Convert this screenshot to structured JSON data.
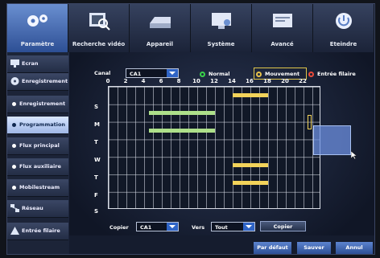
{
  "tabs": [
    {
      "label": "Paramètre",
      "icon": "gears-icon"
    },
    {
      "label": "Recherche vidéo",
      "icon": "video-search-icon"
    },
    {
      "label": "Appareil",
      "icon": "hard-drive-icon"
    },
    {
      "label": "Système",
      "icon": "monitor-icon"
    },
    {
      "label": "Avancé",
      "icon": "advanced-window-icon"
    },
    {
      "label": "Eteindre",
      "icon": "power-icon"
    }
  ],
  "sidebar": {
    "items": [
      {
        "label": "Ecran",
        "type": "group",
        "icon": "monitor-icon"
      },
      {
        "label": "Enregistrement",
        "type": "group",
        "icon": "film-reel-icon"
      },
      {
        "label": "Enregistrement",
        "type": "sub"
      },
      {
        "label": "Programmation",
        "type": "sub",
        "selected": true
      },
      {
        "label": "Flux principal",
        "type": "sub"
      },
      {
        "label": "Flux auxiliaire",
        "type": "sub"
      },
      {
        "label": "Mobilestream",
        "type": "sub"
      },
      {
        "label": "Réseau",
        "type": "group",
        "icon": "network-icon"
      },
      {
        "label": "Entrée filaire",
        "type": "group",
        "icon": "alarm-icon"
      }
    ]
  },
  "schedule": {
    "canal_label": "Canal",
    "canal_value": "CA1",
    "legend": [
      {
        "label": "Normal",
        "color": "#3ad24a"
      },
      {
        "label": "Mouvement",
        "color": "#e8c34a"
      },
      {
        "label": "Entrée filaire",
        "color": "#e84a3a"
      }
    ],
    "hours": [
      "0",
      "2",
      "4",
      "6",
      "8",
      "10",
      "12",
      "14",
      "16",
      "18",
      "20",
      "22"
    ],
    "days": [
      "S",
      "M",
      "T",
      "W",
      "T",
      "F",
      "S"
    ],
    "segments": [
      {
        "day": 0,
        "start": 14,
        "end": 18,
        "type": "Mouvement"
      },
      {
        "day": 1,
        "start": 4.5,
        "end": 12,
        "type": "Normal"
      },
      {
        "day": 2,
        "start": 4.5,
        "end": 12,
        "type": "Normal"
      },
      {
        "day": 4,
        "start": 14,
        "end": 18,
        "type": "Mouvement"
      },
      {
        "day": 5,
        "start": 14,
        "end": 18,
        "type": "Mouvement"
      }
    ],
    "copy": {
      "label": "Copier",
      "from": "CA1",
      "to_label": "Vers",
      "to": "Tout",
      "button": "Copier"
    }
  },
  "footer": {
    "default": "Par défaut",
    "save": "Sauver",
    "cancel": "Annul"
  },
  "colors": {
    "normal": "#aee08a",
    "motion": "#f3d35a",
    "selection": "#6c8fe0"
  }
}
